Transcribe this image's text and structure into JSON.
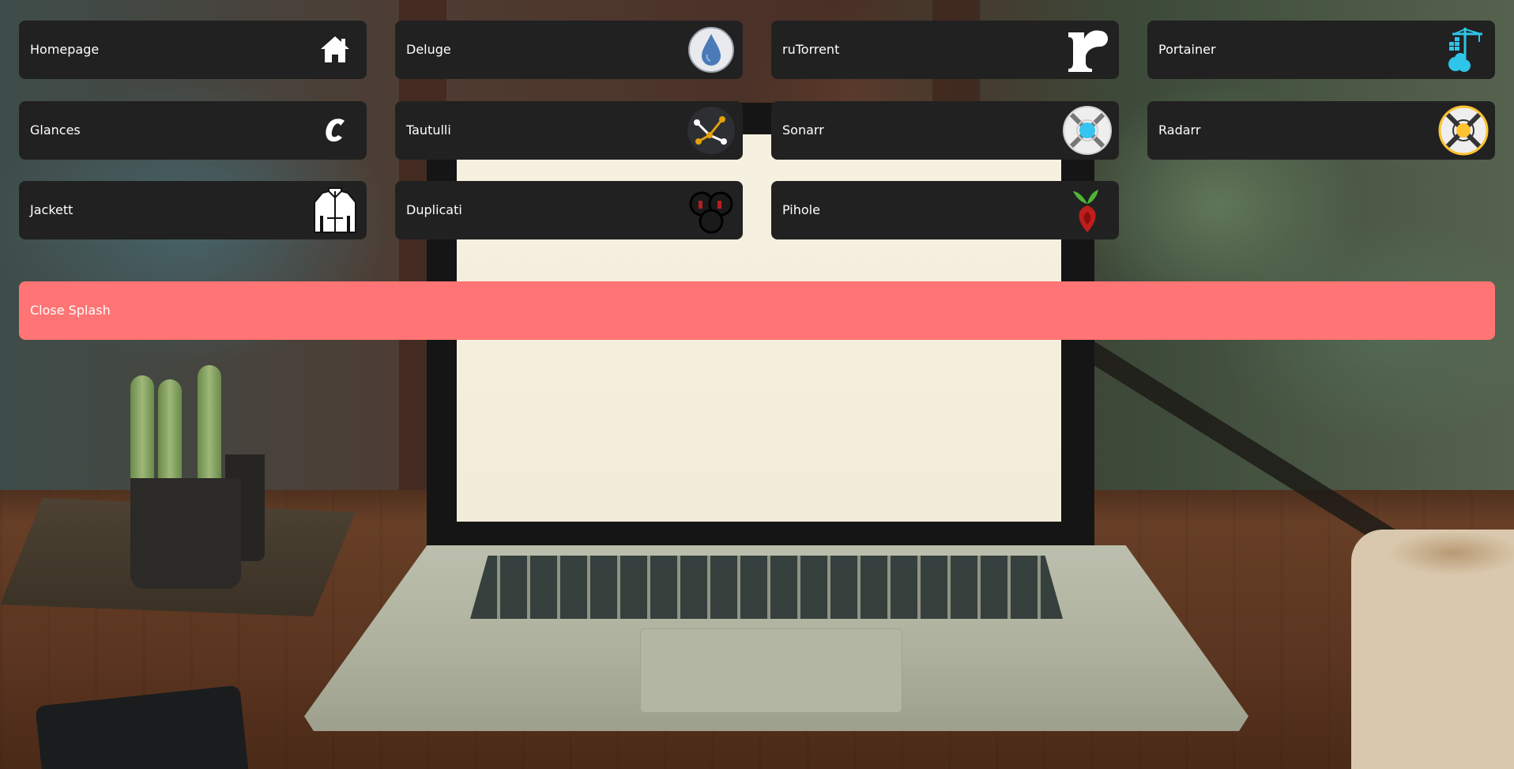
{
  "tiles": [
    {
      "label": "Homepage",
      "icon": "home-icon"
    },
    {
      "label": "Deluge",
      "icon": "deluge-icon"
    },
    {
      "label": "ruTorrent",
      "icon": "rutorrent-icon"
    },
    {
      "label": "Portainer",
      "icon": "portainer-icon"
    },
    {
      "label": "Glances",
      "icon": "glances-icon"
    },
    {
      "label": "Tautulli",
      "icon": "tautulli-icon"
    },
    {
      "label": "Sonarr",
      "icon": "sonarr-icon"
    },
    {
      "label": "Radarr",
      "icon": "radarr-icon"
    },
    {
      "label": "Jackett",
      "icon": "jackett-icon"
    },
    {
      "label": "Duplicati",
      "icon": "duplicati-icon"
    },
    {
      "label": "Pihole",
      "icon": "pihole-icon"
    }
  ],
  "close_splash": {
    "label": "Close Splash"
  },
  "colors": {
    "tile_bg": "#212121",
    "tile_text": "#ffffff",
    "close_bg": "#ff7474"
  }
}
